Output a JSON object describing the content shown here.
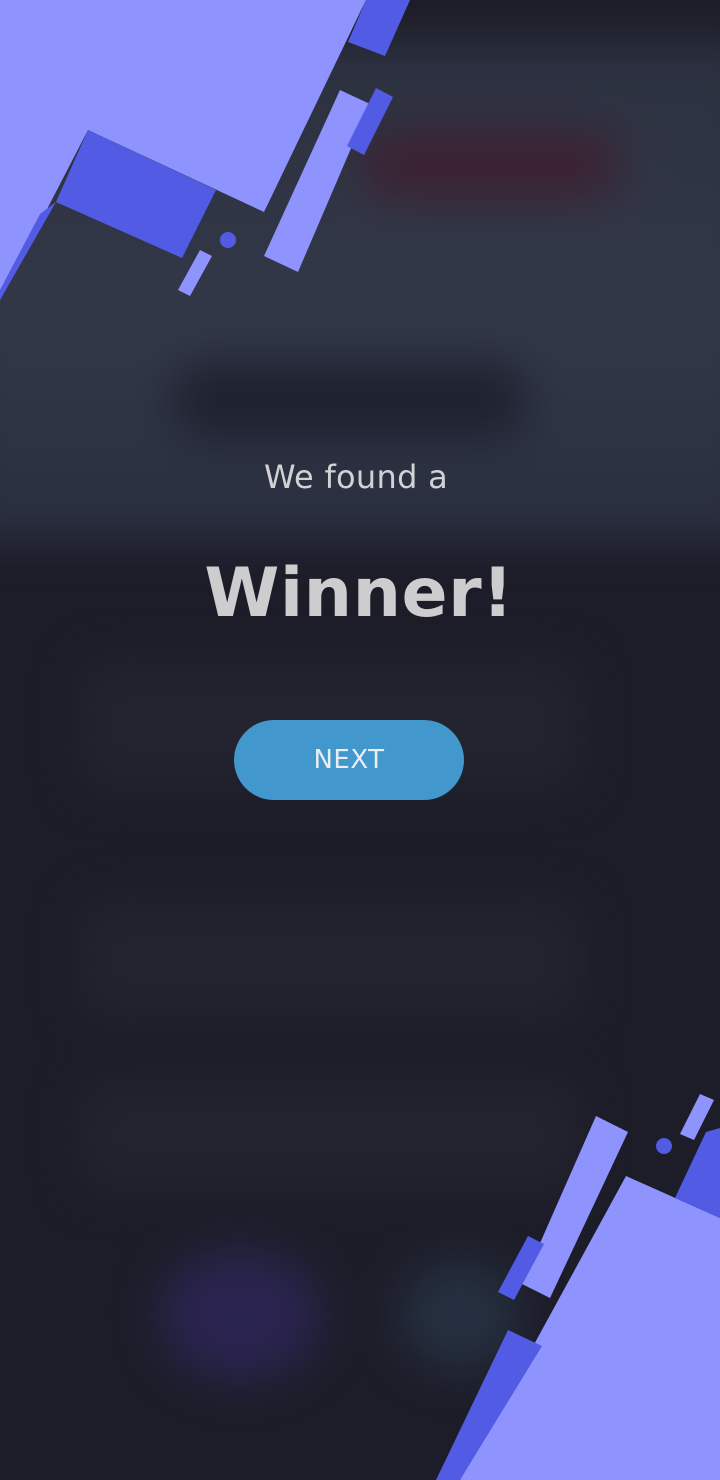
{
  "result": {
    "intro": "We found a",
    "headline": "Winner!"
  },
  "actions": {
    "next_label": "NEXT"
  },
  "colors": {
    "background": "#1d1d29",
    "accent_light": "#8e93fd",
    "accent_dark": "#525be3",
    "button": "#4297cc",
    "text": "#cdcdcf"
  }
}
